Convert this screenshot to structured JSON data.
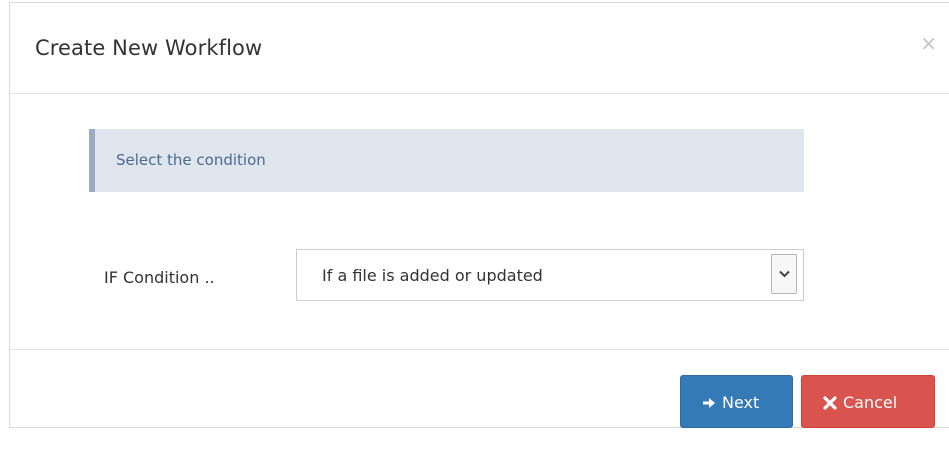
{
  "dialog": {
    "title": "Create New Workflow",
    "close_symbol": "×"
  },
  "info": {
    "text": "Select the condition"
  },
  "condition": {
    "label": "IF Condition ..",
    "selected_value": "If a file is added or updated"
  },
  "footer": {
    "next_label": "Next",
    "cancel_label": "Cancel"
  },
  "icons": {
    "next": "arrow-right-icon",
    "cancel": "times-icon",
    "select": "chevron-down-icon",
    "close": "close-icon"
  },
  "colors": {
    "primary": "#337ab7",
    "danger": "#d9534f",
    "info_bg": "#dfe5ed",
    "info_border": "#97acc4",
    "info_text": "#4a6a92"
  }
}
